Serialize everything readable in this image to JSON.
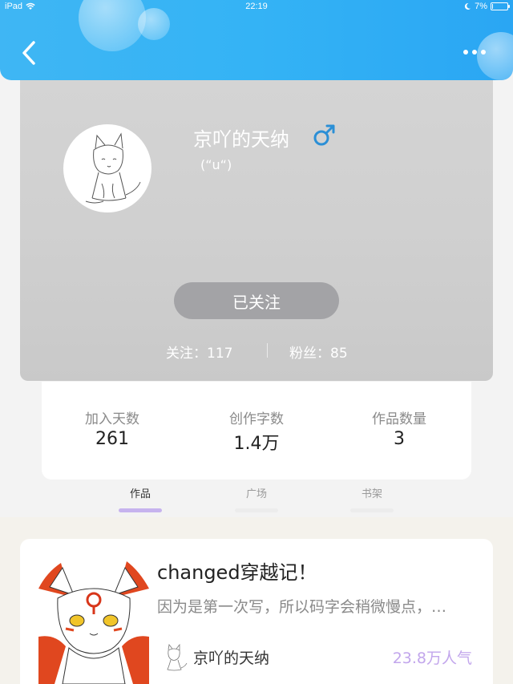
{
  "status_bar": {
    "device": "iPad",
    "time": "22:19",
    "battery": "7%",
    "battery_level": 0.07
  },
  "header": {
    "back_icon": "chevron-left-icon",
    "more_icon": "more-dots-icon"
  },
  "profile": {
    "nickname": "京吖的天纳",
    "gender_symbol": "♂",
    "gender_color": "#2b8fd6",
    "signature": "(“u“)",
    "follow_button": "已关注",
    "follow_label": "关注：117",
    "fans_label": "粉丝：85"
  },
  "stats": [
    {
      "label": "加入天数",
      "value": "261"
    },
    {
      "label": "创作字数",
      "value": "1.4万"
    },
    {
      "label": "作品数量",
      "value": "3"
    }
  ],
  "tabs": [
    {
      "label": "作品",
      "active": true
    },
    {
      "label": "广场",
      "active": false
    },
    {
      "label": "书架",
      "active": false
    }
  ],
  "work": {
    "title": "changed穿越记！",
    "description": "因为是第一次写，所以码字会稍微慢点，…",
    "author": "京吖的天纳",
    "popularity": "23.8万人气"
  },
  "colors": {
    "header": "#34b3f5",
    "accent_purple": "#c6b3ee",
    "popularity": "#c2a6ec"
  }
}
